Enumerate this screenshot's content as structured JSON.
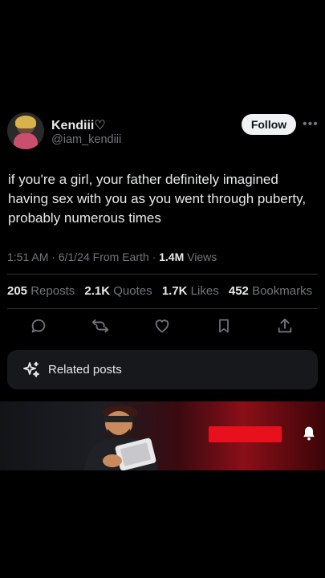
{
  "author": {
    "name": "Kendiii♡",
    "handle": "@iam_kendiii"
  },
  "follow_label": "Follow",
  "more_label": "•••",
  "tweet": {
    "text": "if you're a girl, your father definitely imagined having sex with you as you went through puberty, probably numerous times",
    "time": "1:51 AM",
    "date": "6/1/24",
    "source": "From Earth",
    "views_count": "1.4M",
    "views_label": "Views",
    "sep": "·"
  },
  "stats": {
    "reposts_count": "205",
    "reposts_label": "Reposts",
    "quotes_count": "2.1K",
    "quotes_label": "Quotes",
    "likes_count": "1.7K",
    "likes_label": "Likes",
    "bookmarks_count": "452",
    "bookmarks_label": "Bookmarks"
  },
  "actions": [
    "reply-icon",
    "repost-icon",
    "like-icon",
    "bookmark-icon",
    "share-icon"
  ],
  "related_posts_label": "Related posts",
  "colors": {
    "background": "#000000",
    "text": "#e7e9ea",
    "muted": "#71767b",
    "divider": "#2f3336",
    "card": "#16181c",
    "follow_bg": "#eff3f4",
    "banner_red": "#e8101c"
  }
}
